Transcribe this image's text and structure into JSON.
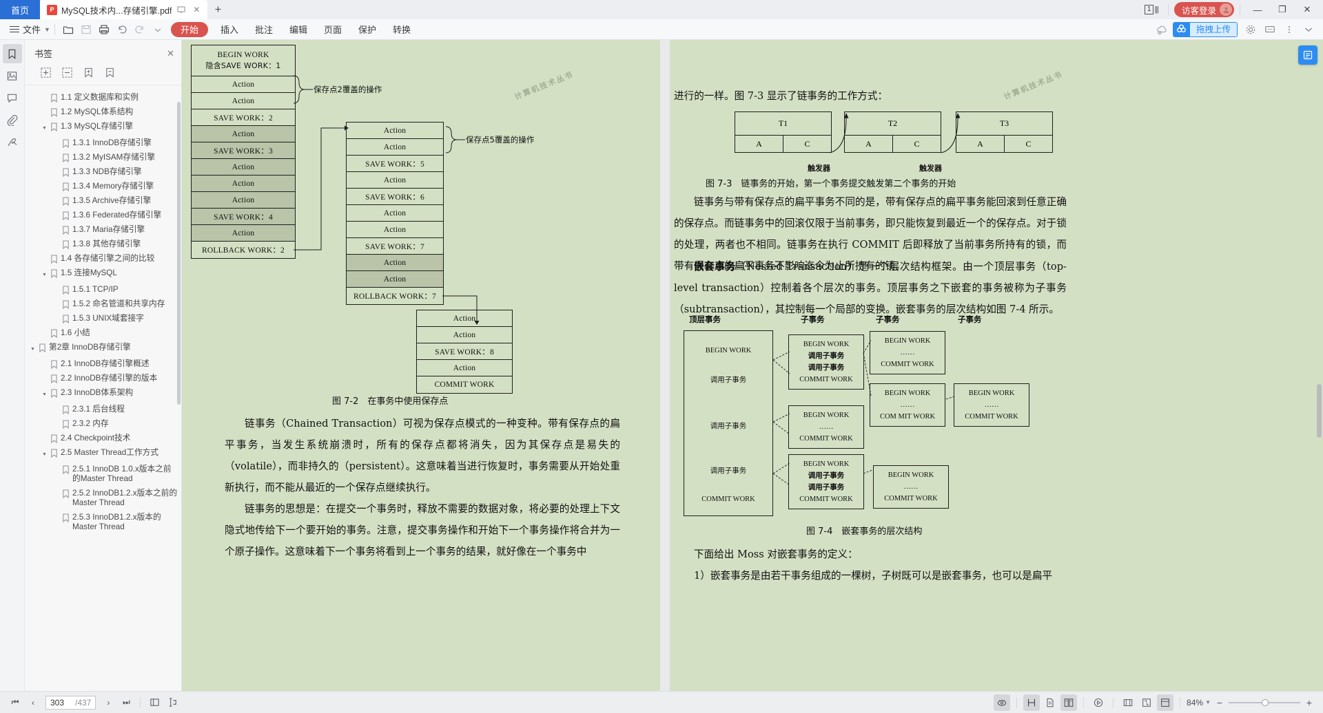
{
  "window": {
    "home_tab": "首页",
    "doc_tab_title": "MySQL技术内...存储引擎.pdf",
    "pdf_badge": "P",
    "new_tab": "+",
    "page_count": "1",
    "login_label": "访客登录",
    "minimize": "—",
    "restore": "❐",
    "close": "✕"
  },
  "menubar": {
    "file_label": "文件",
    "start_label": "开始",
    "items": [
      "插入",
      "批注",
      "编辑",
      "页面",
      "保护",
      "转换"
    ],
    "upload_label": "拖拽上传"
  },
  "rail": {
    "items": [
      {
        "name": "bookmark-icon",
        "active": true
      },
      {
        "name": "thumbnail-icon",
        "active": false
      },
      {
        "name": "comment-icon",
        "active": false
      },
      {
        "name": "attachment-icon",
        "active": false
      },
      {
        "name": "signature-icon",
        "active": false
      }
    ]
  },
  "bookmarks": {
    "title": "书签",
    "close": "✕",
    "tools": [
      "expand-all-icon",
      "collapse-all-icon",
      "add-bookmark-icon",
      "edit-bookmark-icon"
    ],
    "items": [
      {
        "label": "1.1 定义数据库和实例",
        "indent": 1,
        "expandable": false
      },
      {
        "label": "1.2 MySQL体系结构",
        "indent": 1,
        "expandable": false
      },
      {
        "label": "1.3 MySQL存储引擎",
        "indent": 1,
        "expandable": true
      },
      {
        "label": "1.3.1 InnoDB存储引擎",
        "indent": 2,
        "expandable": false
      },
      {
        "label": "1.3.2 MyISAM存储引擎",
        "indent": 2,
        "expandable": false
      },
      {
        "label": "1.3.3 NDB存储引擎",
        "indent": 2,
        "expandable": false
      },
      {
        "label": "1.3.4 Memory存储引擎",
        "indent": 2,
        "expandable": false
      },
      {
        "label": "1.3.5 Archive存储引擎",
        "indent": 2,
        "expandable": false
      },
      {
        "label": "1.3.6 Federated存储引擎",
        "indent": 2,
        "expandable": false
      },
      {
        "label": "1.3.7 Maria存储引擎",
        "indent": 2,
        "expandable": false
      },
      {
        "label": "1.3.8 其他存储引擎",
        "indent": 2,
        "expandable": false
      },
      {
        "label": "1.4 各存储引擎之间的比较",
        "indent": 1,
        "expandable": false
      },
      {
        "label": "1.5 连接MySQL",
        "indent": 1,
        "expandable": true
      },
      {
        "label": "1.5.1 TCP/IP",
        "indent": 2,
        "expandable": false
      },
      {
        "label": "1.5.2 命名管道和共享内存",
        "indent": 2,
        "expandable": false
      },
      {
        "label": "1.5.3 UNIX域套接字",
        "indent": 2,
        "expandable": false
      },
      {
        "label": "1.6 小结",
        "indent": 1,
        "expandable": false
      },
      {
        "label": "第2章 InnoDB存储引擎",
        "indent": 0,
        "expandable": true
      },
      {
        "label": "2.1 InnoDB存储引擎概述",
        "indent": 1,
        "expandable": false
      },
      {
        "label": "2.2 InnoDB存储引擎的版本",
        "indent": 1,
        "expandable": false
      },
      {
        "label": "2.3 InnoDB体系架构",
        "indent": 1,
        "expandable": true
      },
      {
        "label": "2.3.1 后台线程",
        "indent": 2,
        "expandable": false
      },
      {
        "label": "2.3.2 内存",
        "indent": 2,
        "expandable": false
      },
      {
        "label": "2.4 Checkpoint技术",
        "indent": 1,
        "expandable": false
      },
      {
        "label": "2.5 Master Thread工作方式",
        "indent": 1,
        "expandable": true
      },
      {
        "label": "2.5.1 InnoDB 1.0.x版本之前的Master Thread",
        "indent": 2,
        "expandable": false
      },
      {
        "label": "2.5.2 InnoDB1.2.x版本之前的Master Thread",
        "indent": 2,
        "expandable": false
      },
      {
        "label": "2.5.3 InnoDB1.2.x版本的Master Thread",
        "indent": 2,
        "expandable": false
      }
    ]
  },
  "left_page": {
    "stamp": "计算机技术丛书",
    "column1": [
      {
        "text": "BEGIN WORK",
        "text2": "隐含SAVE WORK：1",
        "shaded": false,
        "tall": true
      },
      {
        "text": "Action",
        "shaded": false
      },
      {
        "text": "Action",
        "shaded": false
      },
      {
        "text": "SAVE WORK：2",
        "shaded": false
      },
      {
        "text": "Action",
        "shaded": true
      },
      {
        "text": "SAVE WORK：3",
        "shaded": true
      },
      {
        "text": "Action",
        "shaded": true
      },
      {
        "text": "Action",
        "shaded": true
      },
      {
        "text": "Action",
        "shaded": true
      },
      {
        "text": "SAVE WORK：4",
        "shaded": true
      },
      {
        "text": "Action",
        "shaded": true
      },
      {
        "text": "ROLLBACK WORK：2",
        "shaded": false
      }
    ],
    "column2": [
      {
        "text": "Action",
        "shaded": false
      },
      {
        "text": "Action",
        "shaded": false
      },
      {
        "text": "SAVE WORK：5",
        "shaded": false
      },
      {
        "text": "Action",
        "shaded": false
      },
      {
        "text": "SAVE WORK：6",
        "shaded": false
      },
      {
        "text": "Action",
        "shaded": false
      },
      {
        "text": "Action",
        "shaded": false
      },
      {
        "text": "SAVE WORK：7",
        "shaded": false
      },
      {
        "text": "Action",
        "shaded": true
      },
      {
        "text": "Action",
        "shaded": true
      },
      {
        "text": "ROLLBACK WORK：7",
        "shaded": false
      }
    ],
    "column3": [
      {
        "text": "Action",
        "shaded": false
      },
      {
        "text": "Action",
        "shaded": false
      },
      {
        "text": "SAVE WORK：8",
        "shaded": false
      },
      {
        "text": "Action",
        "shaded": false
      },
      {
        "text": "COMMIT WORK",
        "shaded": false
      }
    ],
    "annotation1": "保存点2覆盖的操作",
    "annotation2": "保存点5覆盖的操作",
    "caption": "图 7-2　在事务中使用保存点",
    "para1": "链事务（Chained Transaction）可视为保存点模式的一种变种。带有保存点的扁平事务，当发生系统崩溃时，所有的保存点都将消失，因为其保存点是易失的（volatile），而非持久的（persistent）。这意味着当进行恢复时，事务需要从开始处重新执行，而不能从最近的一个保存点继续执行。",
    "para2": "链事务的思想是：在提交一个事务时，释放不需要的数据对象，将必要的处理上下文隐式地传给下一个要开始的事务。注意，提交事务操作和开始下一个事务操作将合并为一个原子操作。这意味着下一个事务将看到上一个事务的结果，就好像在一个事务中"
  },
  "right_page": {
    "stamp": "计算机技术丛书",
    "line1": "进行的一样。图 7-3 显示了链事务的工作方式：",
    "chain_boxes": [
      {
        "name": "T1",
        "a": "A",
        "c": "C"
      },
      {
        "name": "T2",
        "a": "A",
        "c": "C"
      },
      {
        "name": "T3",
        "a": "A",
        "c": "C"
      }
    ],
    "trigger_label": "触发器",
    "caption73": "图 7-3　链事务的开始，第一个事务提交触发第二个事务的开始",
    "para1": "链事务与带有保存点的扁平事务不同的是，带有保存点的扁平事务能回滚到任意正确的保存点。而链事务中的回滚仅限于当前事务，即只能恢复到最近一个的保存点。对于锁的处理，两者也不相同。链事务在执行 COMMIT 后即释放了当前事务所持有的锁，而带有保存点的扁平事务不影响迄今为止所持有的锁。",
    "para2_head": "嵌套事务",
    "para2": "（Nested Transaction）是一个层次结构框架。由一个顶层事务（top-level transaction）控制着各个层次的事务。顶层事务之下嵌套的事务被称为子事务（subtransaction），其控制每一个局部的变换。嵌套事务的层次结构如图 7-4 所示。",
    "nested_headers": [
      "顶层事务",
      "子事务",
      "子事务",
      "子事务"
    ],
    "nested_top": [
      "BEGIN WORK",
      "调用子事务",
      "调用子事务",
      "调用子事务",
      "COMMIT WORK"
    ],
    "nested_boxes": [
      {
        "lines": [
          "BEGIN WORK",
          "调用子事务",
          "调用子事务",
          "COMMIT WORK"
        ]
      },
      {
        "lines": [
          "BEGIN WORK",
          "……",
          "COMMIT WORK"
        ]
      },
      {
        "lines": [
          "BEGIN WORK",
          "……",
          "COM MIT WORK"
        ]
      },
      {
        "lines": [
          "BEGIN WORK",
          "……",
          "COMMIT WORK"
        ]
      },
      {
        "lines": [
          "BEGIN WORK",
          "……",
          "COMMIT WORK"
        ]
      },
      {
        "lines": [
          "BEGIN WORK",
          "调用子事务",
          "调用子事务",
          "COMMIT WORK"
        ]
      },
      {
        "lines": [
          "BEGIN WORK",
          "……",
          "COMMIT WORK"
        ]
      }
    ],
    "caption74": "图 7-4　嵌套事务的层次结构",
    "para3": "下面给出 Moss 对嵌套事务的定义：",
    "para4": "1）嵌套事务是由若干事务组成的一棵树，子树既可以是嵌套事务，也可以是扁平"
  },
  "status": {
    "first_page": "⏮",
    "prev_page": "‹",
    "page_current": "303",
    "page_total": "/437",
    "next_page": "›",
    "last_page": "⏭",
    "zoom_value": "84%",
    "zoom_out": "−",
    "zoom_in": "+",
    "icons": [
      "read-mode-icon",
      "single-page-icon",
      "continuous-page-icon",
      "facing-page-icon",
      "presentation-icon",
      "fit-width-icon",
      "fit-page-icon",
      "crop-icon"
    ]
  }
}
